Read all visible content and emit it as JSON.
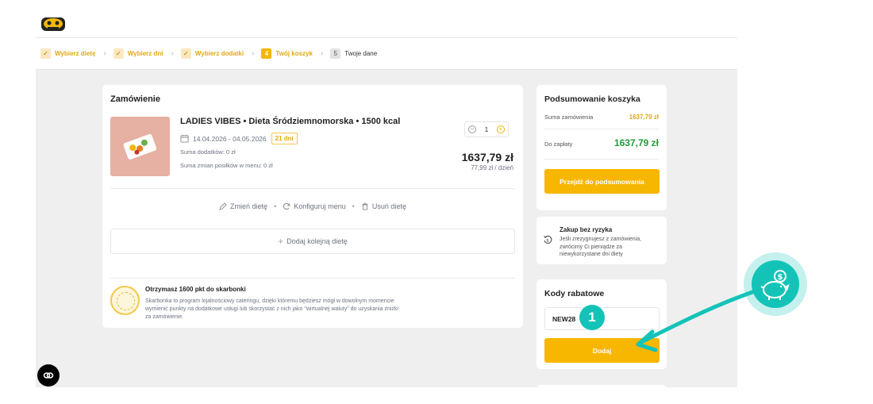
{
  "steps": [
    {
      "number": "✓",
      "label": "Wybierz dietę",
      "state": "done"
    },
    {
      "number": "✓",
      "label": "Wybierz dni",
      "state": "done"
    },
    {
      "number": "✓",
      "label": "Wybierz dodatki",
      "state": "done"
    },
    {
      "number": "4",
      "label": "Twój koszyk",
      "state": "active"
    },
    {
      "number": "5",
      "label": "Twoje dane",
      "state": "todo"
    }
  ],
  "order": {
    "title": "Zamówienie",
    "diet_name": "LADIES VIBES • Dieta Śródziemnomorska • 1500 kcal",
    "date_range": "14.04.2026 - 04.05.2026",
    "days_badge": "21 dni",
    "addons_sum": "Suma dodatków: 0 zł",
    "menu_changes_sum": "Suma zmian posiłków w menu: 0 zł",
    "quantity": "1",
    "price": "1637,79 zł",
    "price_per_day": "77,99 zł / dzień",
    "actions": {
      "change": "Zmień dietę",
      "configure": "Konfiguruj menu",
      "remove": "Usuń dietę"
    },
    "add_diet": "Dodaj kolejną dietę",
    "points_title": "Otrzymasz 1600 pkt do skarbonki",
    "points_text": "Skarbonka to program lojalnościowy cateringu, dzięki któremu będziesz mógł w dowolnym momencie wymienić punkty na dodatkowe usługi lub skorzystać z nich jako \"wirtualnej waluty\" do uzyskania zniżki za zamówienie."
  },
  "summary": {
    "title": "Podsumowanie koszyka",
    "total_label": "Suma zamówienia",
    "total_value": "1637,79 zł",
    "pay_label": "Do zapłaty",
    "pay_value": "1637,79 zł",
    "button": "Przejdź do podsumowania"
  },
  "norisk": {
    "title": "Zakup bez ryzyka",
    "text": "Jeśli zrezygnujesz z zamówienia, zwrócimy Ci pieniądze za niewykorzystane dni diety"
  },
  "coupons": {
    "title": "Kody rabatowe",
    "code": "NEW28",
    "button": "Dodaj"
  },
  "tutorial": {
    "step_number": "1"
  },
  "colors": {
    "accent": "#f7b600",
    "teal": "#14c3b8",
    "green": "#1e9e3a"
  }
}
